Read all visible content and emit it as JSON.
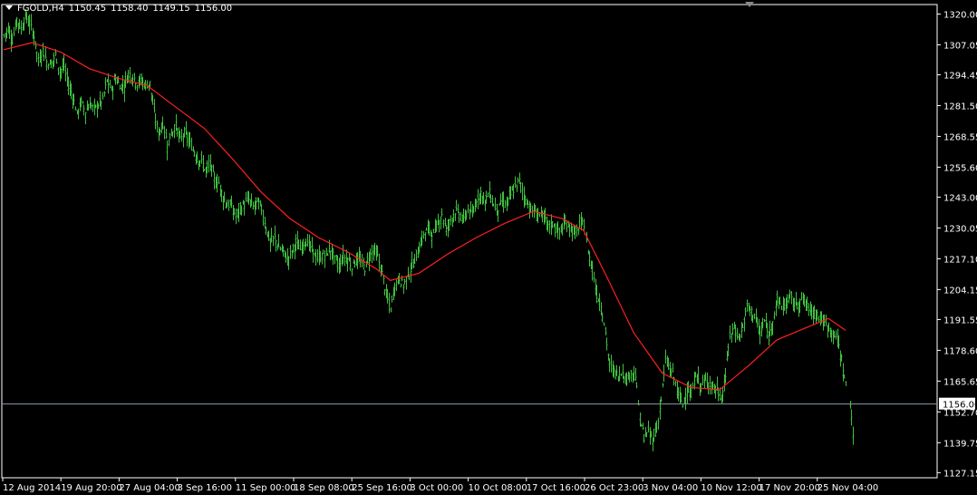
{
  "header": {
    "symbol": "FGOLD,H4",
    "open": "1150.45",
    "high": "1158.40",
    "low": "1149.15",
    "close": "1156.00"
  },
  "colors": {
    "background": "#000000",
    "bars": "#3fbf3f",
    "moving_average": "#ff2020",
    "axes": "#ffffff",
    "bid_line": "#8a9aa8"
  },
  "chart_data": {
    "type": "line",
    "title": "FGOLD,H4",
    "y_ticks": [
      "1320.00",
      "1307.05",
      "1294.45",
      "1281.50",
      "1268.55",
      "1255.60",
      "1243.00",
      "1230.05",
      "1217.10",
      "1204.15",
      "1191.55",
      "1178.60",
      "1165.65",
      "1152.70",
      "1139.75",
      "1127.15"
    ],
    "y_tick_values": [
      1320.0,
      1307.05,
      1294.45,
      1281.5,
      1268.55,
      1255.6,
      1243.0,
      1230.05,
      1217.1,
      1204.15,
      1191.55,
      1178.6,
      1165.65,
      1152.7,
      1139.75,
      1127.15
    ],
    "ylim": [
      1125.0,
      1324.0
    ],
    "x_ticks": [
      "12 Aug 2014",
      "19 Aug 20:00",
      "27 Aug 04:00",
      "3 Sep 16:00",
      "11 Sep 00:00",
      "18 Sep 08:00",
      "25 Sep 16:00",
      "3 Oct 00:00",
      "10 Oct 08:00",
      "17 Oct 16:00",
      "26 Oct 23:00",
      "3 Nov 04:00",
      "10 Nov 12:00",
      "17 Nov 20:00",
      "25 Nov 04:00"
    ],
    "current_price": "1156.00",
    "current_value": 1156.0,
    "series": [
      {
        "kind": "ohlc",
        "values": [
          [
            0,
            1311
          ],
          [
            3,
            1314
          ],
          [
            6,
            1309
          ],
          [
            9,
            1318
          ],
          [
            12,
            1314
          ],
          [
            15,
            1319
          ],
          [
            18,
            1316
          ],
          [
            21,
            1311
          ],
          [
            24,
            1300
          ],
          [
            27,
            1305
          ],
          [
            30,
            1300
          ],
          [
            33,
            1299
          ],
          [
            36,
            1303
          ],
          [
            39,
            1296
          ],
          [
            42,
            1298
          ],
          [
            45,
            1290
          ],
          [
            48,
            1286
          ],
          [
            51,
            1278
          ],
          [
            54,
            1283
          ],
          [
            57,
            1279
          ],
          [
            60,
            1282
          ],
          [
            63,
            1280
          ],
          [
            66,
            1282
          ],
          [
            69,
            1284
          ],
          [
            72,
            1292
          ],
          [
            75,
            1288
          ],
          [
            78,
            1293
          ],
          [
            81,
            1290
          ],
          [
            84,
            1290
          ],
          [
            87,
            1295
          ],
          [
            90,
            1294
          ],
          [
            93,
            1291
          ],
          [
            96,
            1292
          ],
          [
            99,
            1290
          ],
          [
            102,
            1291
          ],
          [
            105,
            1278
          ],
          [
            108,
            1270
          ],
          [
            111,
            1274
          ],
          [
            114,
            1265
          ],
          [
            117,
            1270
          ],
          [
            120,
            1273
          ],
          [
            123,
            1267
          ],
          [
            126,
            1270
          ],
          [
            129,
            1267
          ],
          [
            132,
            1263
          ],
          [
            135,
            1260
          ],
          [
            138,
            1258
          ],
          [
            141,
            1254
          ],
          [
            144,
            1257
          ],
          [
            147,
            1250
          ],
          [
            150,
            1249
          ],
          [
            153,
            1243
          ],
          [
            156,
            1240
          ],
          [
            159,
            1239
          ],
          [
            162,
            1235
          ],
          [
            165,
            1238
          ],
          [
            168,
            1240
          ],
          [
            171,
            1242
          ],
          [
            174,
            1239
          ],
          [
            177,
            1241
          ],
          [
            180,
            1238
          ],
          [
            183,
            1230
          ],
          [
            186,
            1224
          ],
          [
            189,
            1226
          ],
          [
            192,
            1222
          ],
          [
            195,
            1220
          ],
          [
            198,
            1217
          ],
          [
            201,
            1220
          ],
          [
            204,
            1224
          ],
          [
            207,
            1221
          ],
          [
            210,
            1225
          ],
          [
            213,
            1223
          ],
          [
            216,
            1220
          ],
          [
            219,
            1217
          ],
          [
            222,
            1218
          ],
          [
            225,
            1219
          ],
          [
            228,
            1221
          ],
          [
            231,
            1217
          ],
          [
            234,
            1214
          ],
          [
            237,
            1218
          ],
          [
            240,
            1217
          ],
          [
            243,
            1214
          ],
          [
            246,
            1217
          ],
          [
            249,
            1216
          ],
          [
            252,
            1213
          ],
          [
            255,
            1218
          ],
          [
            258,
            1221
          ],
          [
            261,
            1218
          ],
          [
            264,
            1211
          ],
          [
            267,
            1202
          ],
          [
            270,
            1196
          ],
          [
            273,
            1206
          ],
          [
            276,
            1209
          ],
          [
            279,
            1206
          ],
          [
            282,
            1210
          ],
          [
            285,
            1214
          ],
          [
            288,
            1218
          ],
          [
            291,
            1224
          ],
          [
            294,
            1228
          ],
          [
            297,
            1230
          ],
          [
            300,
            1227
          ],
          [
            303,
            1232
          ],
          [
            306,
            1236
          ],
          [
            309,
            1229
          ],
          [
            312,
            1234
          ],
          [
            315,
            1237
          ],
          [
            318,
            1236
          ],
          [
            321,
            1233
          ],
          [
            324,
            1238
          ],
          [
            327,
            1235
          ],
          [
            330,
            1242
          ],
          [
            333,
            1245
          ],
          [
            336,
            1241
          ],
          [
            339,
            1245
          ],
          [
            342,
            1240
          ],
          [
            345,
            1238
          ],
          [
            348,
            1241
          ],
          [
            351,
            1240
          ],
          [
            354,
            1244
          ],
          [
            357,
            1247
          ],
          [
            360,
            1250
          ],
          [
            363,
            1244
          ],
          [
            366,
            1240
          ],
          [
            369,
            1237
          ],
          [
            372,
            1236
          ],
          [
            375,
            1236
          ],
          [
            378,
            1233
          ],
          [
            381,
            1231
          ],
          [
            384,
            1232
          ],
          [
            387,
            1228
          ],
          [
            390,
            1230
          ],
          [
            393,
            1232
          ],
          [
            396,
            1230
          ],
          [
            399,
            1227
          ],
          [
            402,
            1231
          ],
          [
            405,
            1232
          ],
          [
            408,
            1220
          ],
          [
            411,
            1213
          ],
          [
            414,
            1202
          ],
          [
            417,
            1198
          ],
          [
            420,
            1186
          ],
          [
            423,
            1172
          ],
          [
            426,
            1170
          ],
          [
            429,
            1168
          ],
          [
            432,
            1170
          ],
          [
            435,
            1166
          ],
          [
            438,
            1170
          ],
          [
            441,
            1168
          ],
          [
            444,
            1150
          ],
          [
            447,
            1142
          ],
          [
            450,
            1144
          ],
          [
            453,
            1141
          ],
          [
            456,
            1146
          ],
          [
            459,
            1158
          ],
          [
            462,
            1174
          ],
          [
            465,
            1171
          ],
          [
            468,
            1167
          ],
          [
            471,
            1160
          ],
          [
            474,
            1156
          ],
          [
            477,
            1163
          ],
          [
            480,
            1159
          ],
          [
            483,
            1169
          ],
          [
            486,
            1164
          ],
          [
            489,
            1165
          ],
          [
            492,
            1166
          ],
          [
            495,
            1163
          ],
          [
            498,
            1162
          ],
          [
            501,
            1158
          ],
          [
            504,
            1168
          ],
          [
            507,
            1185
          ],
          [
            510,
            1188
          ],
          [
            513,
            1184
          ],
          [
            516,
            1188
          ],
          [
            519,
            1197
          ],
          [
            522,
            1195
          ],
          [
            525,
            1192
          ],
          [
            528,
            1185
          ],
          [
            531,
            1191
          ],
          [
            534,
            1184
          ],
          [
            537,
            1192
          ],
          [
            540,
            1200
          ],
          [
            543,
            1197
          ],
          [
            546,
            1198
          ],
          [
            549,
            1201
          ],
          [
            552,
            1198
          ],
          [
            555,
            1199
          ],
          [
            558,
            1200
          ],
          [
            561,
            1197
          ],
          [
            564,
            1195
          ],
          [
            567,
            1195
          ],
          [
            570,
            1192
          ],
          [
            573,
            1190
          ],
          [
            576,
            1188
          ],
          [
            579,
            1186
          ],
          [
            582,
            1183
          ],
          [
            585,
            1175
          ],
          [
            588,
            1163
          ]
        ]
      },
      {
        "kind": "ohlc",
        "values": [
          [
            591,
            1157
          ],
          [
            593,
            1144
          ]
        ]
      },
      {
        "kind": "moving_average",
        "values": [
          [
            0,
            1305
          ],
          [
            20,
            1308
          ],
          [
            40,
            1304
          ],
          [
            60,
            1297
          ],
          [
            80,
            1293
          ],
          [
            100,
            1290
          ],
          [
            120,
            1281
          ],
          [
            140,
            1272
          ],
          [
            160,
            1259
          ],
          [
            180,
            1245
          ],
          [
            200,
            1234
          ],
          [
            220,
            1226
          ],
          [
            240,
            1220
          ],
          [
            260,
            1213
          ],
          [
            270,
            1208
          ],
          [
            290,
            1211
          ],
          [
            310,
            1219
          ],
          [
            330,
            1226
          ],
          [
            350,
            1232
          ],
          [
            370,
            1237
          ],
          [
            390,
            1234
          ],
          [
            405,
            1229
          ],
          [
            420,
            1211
          ],
          [
            440,
            1186
          ],
          [
            460,
            1169
          ],
          [
            480,
            1163
          ],
          [
            500,
            1162
          ],
          [
            520,
            1172
          ],
          [
            540,
            1183
          ],
          [
            560,
            1188
          ],
          [
            576,
            1192
          ],
          [
            588,
            1187
          ]
        ]
      }
    ]
  }
}
